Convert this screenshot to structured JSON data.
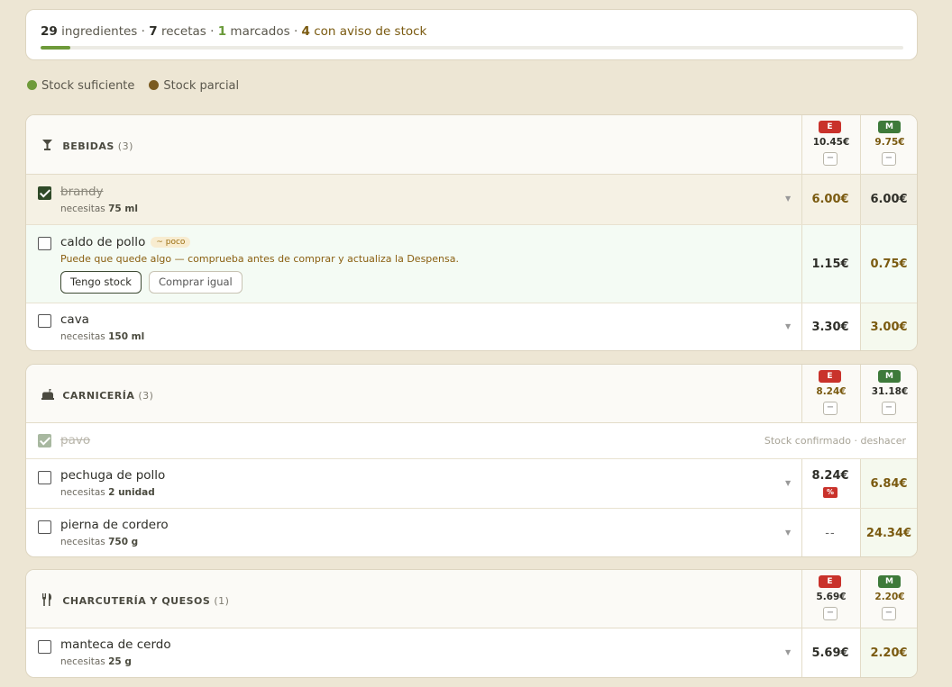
{
  "summary": {
    "ingredients_count": "29",
    "ingredients_label": "ingredientes",
    "recipes_count": "7",
    "recipes_label": "recetas",
    "marked_count": "1",
    "marked_label": "marcados",
    "stock_warning_count": "4",
    "stock_warning_label": "con aviso de stock",
    "separator": "·",
    "progress_percent": 3.4
  },
  "legend": {
    "sufficient": "Stock suficiente",
    "partial": "Stock parcial",
    "sufficient_color": "#6e9a3a",
    "partial_color": "#7a5a20"
  },
  "stores": {
    "e": "E",
    "m": "M"
  },
  "toggle_symbol": "−",
  "categories": [
    {
      "title": "BEBIDAS",
      "count": "(3)",
      "icon": "cocktail-icon",
      "total_e": "10.45€",
      "total_m": "9.75€",
      "items": [
        {
          "name": "brandy",
          "need_prefix": "necesitas",
          "need_qty": "75 ml",
          "price_e": "6.00€",
          "price_m": "6.00€"
        },
        {
          "name": "caldo de pollo",
          "badge": "~ poco",
          "note": "Puede que quede algo — comprueba antes de comprar y actualiza la Despensa.",
          "btn_have": "Tengo stock",
          "btn_buy": "Comprar igual",
          "price_e": "1.15€",
          "price_m": "0.75€"
        },
        {
          "name": "cava",
          "need_prefix": "necesitas",
          "need_qty": "150 ml",
          "price_e": "3.30€",
          "price_m": "3.00€"
        }
      ]
    },
    {
      "title": "CARNICERÍA",
      "count": "(3)",
      "icon": "butcher-icon",
      "total_e": "8.24€",
      "total_m": "31.18€",
      "items": [
        {
          "name": "pavo",
          "status": "Stock confirmado · deshacer"
        },
        {
          "name": "pechuga de pollo",
          "need_prefix": "necesitas",
          "need_qty": "2 unidad",
          "price_e": "8.24€",
          "discount": "%",
          "price_m": "6.84€"
        },
        {
          "name": "pierna de cordero",
          "need_prefix": "necesitas",
          "need_qty": "750 g",
          "price_e": "--",
          "price_m": "24.34€"
        }
      ]
    },
    {
      "title": "CHARCUTERÍA Y QUESOS",
      "count": "(1)",
      "icon": "cutlery-icon",
      "total_e": "5.69€",
      "total_m": "2.20€",
      "items": [
        {
          "name": "manteca de cerdo",
          "need_prefix": "necesitas",
          "need_qty": "25 g",
          "price_e": "5.69€",
          "price_m": "2.20€"
        }
      ]
    }
  ]
}
